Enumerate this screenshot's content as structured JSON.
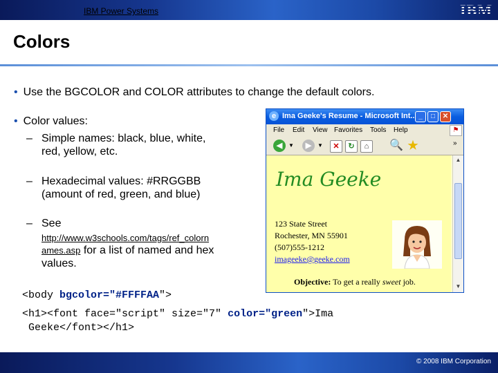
{
  "header": {
    "title": "IBM Power Systems",
    "logo": "IBM"
  },
  "footer": {
    "copyright": "© 2008 IBM Corporation"
  },
  "slide": {
    "title": "Colors",
    "bullet1": "Use the BGCOLOR and COLOR attributes to change the default colors.",
    "bullet2": "Color values:",
    "sub1_label": "Simple names",
    "sub1_rest": ":  black, blue, white,",
    "sub1_line2": "red, yellow, etc.",
    "sub2_label": "Hexadecimal values",
    "sub2_rest": ":  #RRGGBB",
    "sub2_line2": "(amount of red, green, and blue)",
    "sub3_label": "See",
    "sub3_link_1": "http://www.w3schools.com/tags/ref_colorn",
    "sub3_link_2": "ames.asp",
    "sub3_rest": " for a list of named and hex",
    "sub3_line3": "values."
  },
  "browser": {
    "window_title": "Ima Geeke's Resume - Microsoft Int...",
    "menu": [
      "File",
      "Edit",
      "View",
      "Favorites",
      "Tools",
      "Help"
    ],
    "page": {
      "heading": "Ima Geeke",
      "address1": "123 State Street",
      "address2": "Rochester, MN 55901",
      "phone": "(507)555-1212",
      "email": "imageeke@geeke.com",
      "objective_label": "Objective:",
      "objective_text": " To get a really ",
      "objective_em": "sweet",
      "objective_end": " job."
    },
    "background_color": "#FFFFAA",
    "heading_color": "green"
  },
  "code": {
    "line1_a": "<body ",
    "line1_b": "bgcolor=\"#FFFFAA",
    "line1_c": "\">",
    "line2_a": "<h1><font face=\"script\" size=\"7\" ",
    "line2_b": "color=\"green",
    "line2_c": "\">Ima",
    "line3": " Geeke</font></h1>"
  }
}
